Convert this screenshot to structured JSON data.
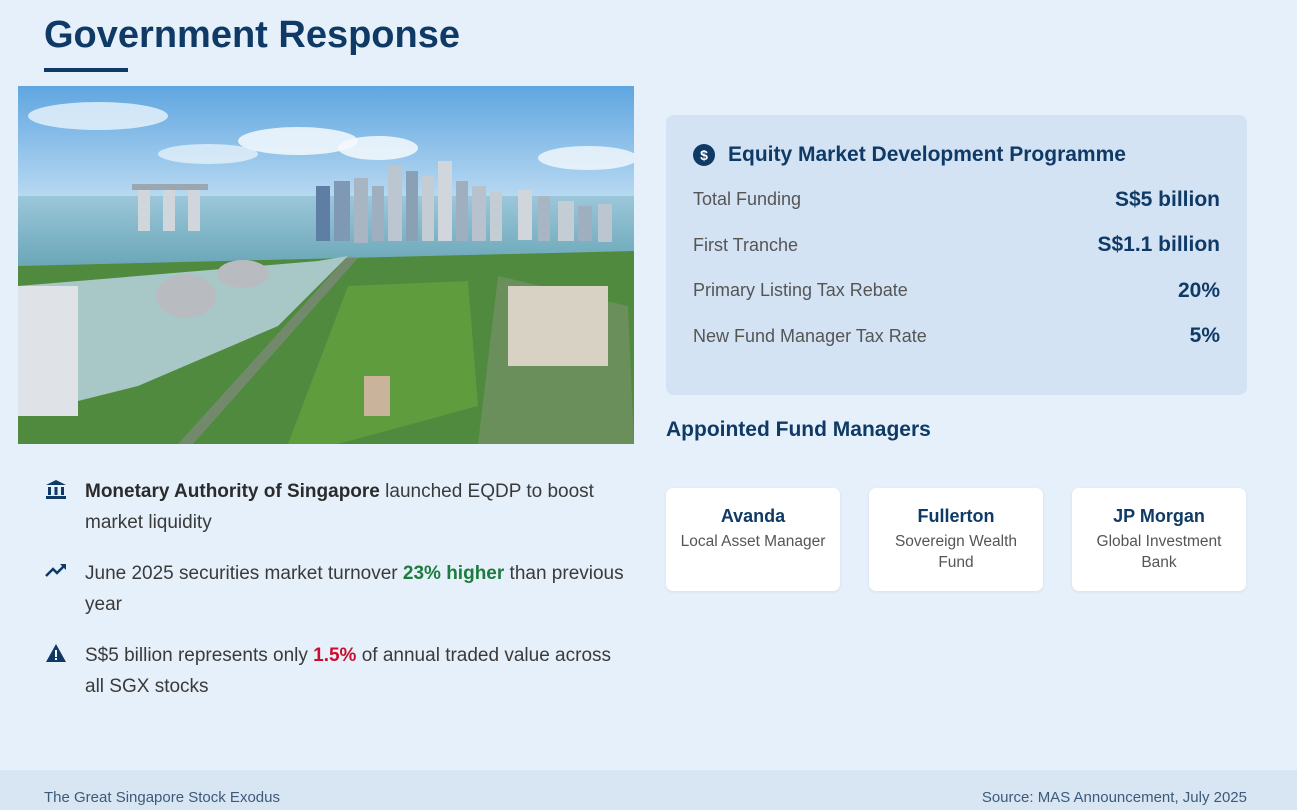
{
  "page": {
    "title": "Government Response"
  },
  "image": {
    "description_icon": "singapore-skyline-photo"
  },
  "bullets": [
    {
      "icon": "bank-icon",
      "bold": "Monetary Authority of Singapore",
      "text": " launched EQDP to boost market liquidity"
    },
    {
      "icon": "trend-up-icon",
      "pre": "June 2025 securities market turnover ",
      "highlight": "23% higher",
      "post": " than previous year"
    },
    {
      "icon": "warning-icon",
      "pre": "S$5 billion represents only ",
      "highlight": "1.5%",
      "post": " of annual traded value across all SGX stocks"
    }
  ],
  "programme": {
    "icon": "dollar-icon",
    "title": "Equity Market Development Programme",
    "metrics": [
      {
        "label": "Total Funding",
        "value": "S$5 billion"
      },
      {
        "label": "First Tranche",
        "value": "S$1.1 billion"
      },
      {
        "label": "Primary Listing Tax Rebate",
        "value": "20%"
      },
      {
        "label": "New Fund Manager Tax Rate",
        "value": "5%"
      }
    ]
  },
  "managers": {
    "title": "Appointed Fund Managers",
    "items": [
      {
        "name": "Avanda",
        "desc": "Local Asset Manager"
      },
      {
        "name": "Fullerton",
        "desc": "Sovereign Wealth Fund"
      },
      {
        "name": "JP Morgan",
        "desc": "Global Investment Bank"
      }
    ]
  },
  "footer": {
    "left": "The Great Singapore Stock Exodus",
    "right": "Source: MAS Announcement, July 2025"
  },
  "colors": {
    "primary": "#0f3a66",
    "positive": "#1e7b3f",
    "negative": "#c8102e",
    "background": "#e6f0fb"
  }
}
